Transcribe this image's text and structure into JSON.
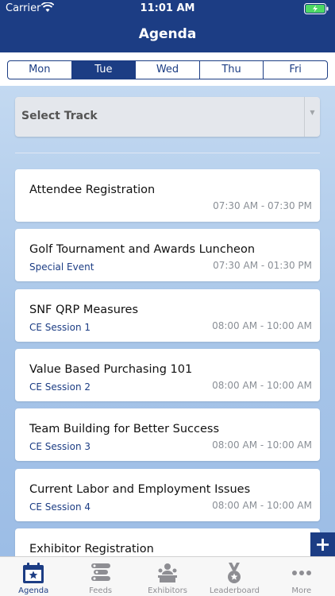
{
  "status": {
    "carrier": "Carrier",
    "time": "11:01 AM"
  },
  "nav": {
    "title": "Agenda"
  },
  "days": [
    "Mon",
    "Tue",
    "Wed",
    "Thu",
    "Fri"
  ],
  "selected_day": "Tue",
  "track_filter": {
    "label": "Select Track"
  },
  "sessions": [
    {
      "title": "Attendee Registration",
      "track": "",
      "time": "07:30 AM - 07:30 PM"
    },
    {
      "title": "Golf Tournament and Awards Luncheon",
      "track": "Special Event",
      "time": "07:30 AM - 01:30 PM"
    },
    {
      "title": "SNF QRP Measures",
      "track": "CE Session 1",
      "time": "08:00 AM - 10:00 AM"
    },
    {
      "title": "Value Based Purchasing 101",
      "track": "CE Session 2",
      "time": "08:00 AM - 10:00 AM"
    },
    {
      "title": "Team Building for Better Success",
      "track": "CE Session 3",
      "time": "08:00 AM - 10:00 AM"
    },
    {
      "title": "Current Labor and Employment Issues",
      "track": "CE Session 4",
      "time": "08:00 AM - 10:00 AM"
    },
    {
      "title": "Exhibitor Registration",
      "track": "",
      "time": ""
    }
  ],
  "fab": {
    "label": "+"
  },
  "tabs": [
    {
      "label": "Agenda",
      "icon": "calendar-star-icon"
    },
    {
      "label": "Feeds",
      "icon": "feeds-icon"
    },
    {
      "label": "Exhibitors",
      "icon": "exhibitors-icon"
    },
    {
      "label": "Leaderboard",
      "icon": "medal-icon"
    },
    {
      "label": "More",
      "icon": "more-dots-icon"
    }
  ],
  "colors": {
    "primary": "#1c3d84",
    "tab_inactive": "#8e8e93",
    "battery": "#4cd964"
  }
}
